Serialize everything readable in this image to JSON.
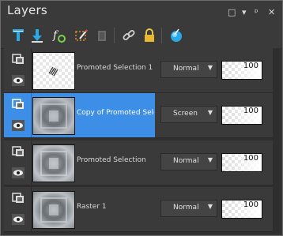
{
  "panel": {
    "title": "Layers"
  },
  "window_controls": {
    "maximize": "□",
    "menu": "▾",
    "pin": "ᵖ",
    "close": "✕"
  },
  "toolbar": {
    "tools": [
      {
        "icon": "new-raster-layer-icon"
      },
      {
        "icon": "merge-down-icon"
      },
      {
        "icon": "layer-styles-icon"
      },
      {
        "icon": "edit-selection-icon"
      },
      {
        "icon": "delete-layer-icon"
      },
      {
        "icon": "link-icon"
      },
      {
        "icon": "lock-icon"
      },
      {
        "icon": "blend-ranges-icon"
      }
    ]
  },
  "layers": [
    {
      "name": "Promoted Selection 1",
      "blend": "Normal",
      "opacity": "100",
      "selected": false
    },
    {
      "name": "Copy of Promoted Selection",
      "blend": "Screen",
      "opacity": "100",
      "selected": true
    },
    {
      "name": "Promoted Selection",
      "blend": "Normal",
      "opacity": "100",
      "selected": false
    },
    {
      "name": "Raster 1",
      "blend": "Normal",
      "opacity": "100",
      "selected": false
    }
  ],
  "colors": {
    "accent": "#3d8ee6",
    "background": "#3a3a3a"
  }
}
